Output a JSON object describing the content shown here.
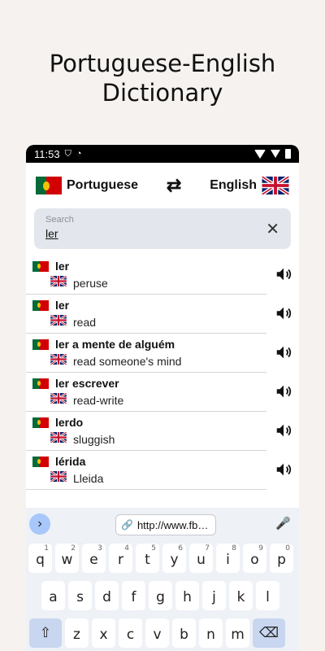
{
  "headline": {
    "line1": "Portuguese-English",
    "line2": "Dictionary"
  },
  "status": {
    "time": "11:53"
  },
  "languages": {
    "source": "Portuguese",
    "target": "English"
  },
  "search": {
    "label": "Search",
    "value": "ler"
  },
  "entries": [
    {
      "pt": "ler",
      "en": "peruse"
    },
    {
      "pt": "ler",
      "en": "read"
    },
    {
      "pt": "ler a mente de alguém",
      "en": "read someone's mind"
    },
    {
      "pt": "ler escrever",
      "en": "read-write"
    },
    {
      "pt": "lerdo",
      "en": "sluggish"
    },
    {
      "pt": "lérida",
      "en": "Lleida"
    }
  ],
  "keyboard": {
    "clipboard_text": "http://www.fb…",
    "row1": [
      {
        "k": "q",
        "n": "1"
      },
      {
        "k": "w",
        "n": "2"
      },
      {
        "k": "e",
        "n": "3"
      },
      {
        "k": "r",
        "n": "4"
      },
      {
        "k": "t",
        "n": "5"
      },
      {
        "k": "y",
        "n": "6"
      },
      {
        "k": "u",
        "n": "7"
      },
      {
        "k": "i",
        "n": "8"
      },
      {
        "k": "o",
        "n": "9"
      },
      {
        "k": "p",
        "n": "0"
      }
    ],
    "row2": [
      "a",
      "s",
      "d",
      "f",
      "g",
      "h",
      "j",
      "k",
      "l"
    ],
    "row3": [
      "z",
      "x",
      "c",
      "v",
      "b",
      "n",
      "m"
    ]
  },
  "colors": {
    "pt_green": "#046a38",
    "pt_red": "#d20000",
    "uk_blue": "#012169",
    "uk_red": "#c8102e"
  }
}
